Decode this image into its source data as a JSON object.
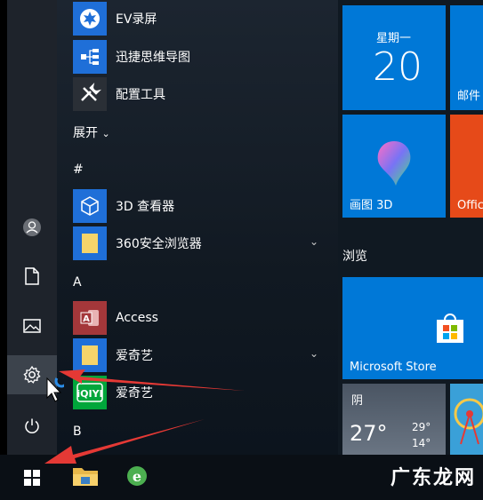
{
  "app_list": {
    "items_top": [
      {
        "label": "EV录屏",
        "icon": "ev-recorder-icon"
      },
      {
        "label": "迅捷思维导图",
        "icon": "mindmap-icon"
      },
      {
        "label": "配置工具",
        "icon": "config-tools-icon"
      }
    ],
    "expand_label": "展开",
    "section_hash": "#",
    "items_hash": [
      {
        "label": "3D 查看器",
        "icon": "3d-viewer-icon"
      },
      {
        "label": "360安全浏览器",
        "icon": "folder-icon"
      }
    ],
    "section_a": "A",
    "items_a": [
      {
        "label": "Access",
        "icon": "access-icon"
      },
      {
        "label": "爱奇艺",
        "icon": "folder-icon"
      },
      {
        "label": "爱奇艺",
        "icon": "iqiyi-icon"
      }
    ],
    "section_b": "B"
  },
  "rail": {
    "buttons": [
      "user-icon",
      "documents-icon",
      "pictures-icon",
      "settings-icon",
      "power-icon"
    ]
  },
  "tiles": {
    "calendar": {
      "weekday": "星期一",
      "day": "20"
    },
    "mail_label": "邮件",
    "paint3d_label": "画图 3D",
    "office_label": "Offic",
    "group_label": "浏览",
    "store_label": "Microsoft Store",
    "weather": {
      "condition": "阴",
      "temp": "27°",
      "high": "29°",
      "low": "14°"
    }
  },
  "taskbar": {
    "start_icon": "windows-start-icon",
    "pinned": [
      "file-explorer-icon",
      "ie-browser-icon"
    ]
  },
  "watermark": "广东龙网",
  "colors": {
    "accent": "#0078d7",
    "tile_blue": "#0078d7",
    "office_orange": "#e64a19",
    "arrow_red": "#e53935"
  }
}
